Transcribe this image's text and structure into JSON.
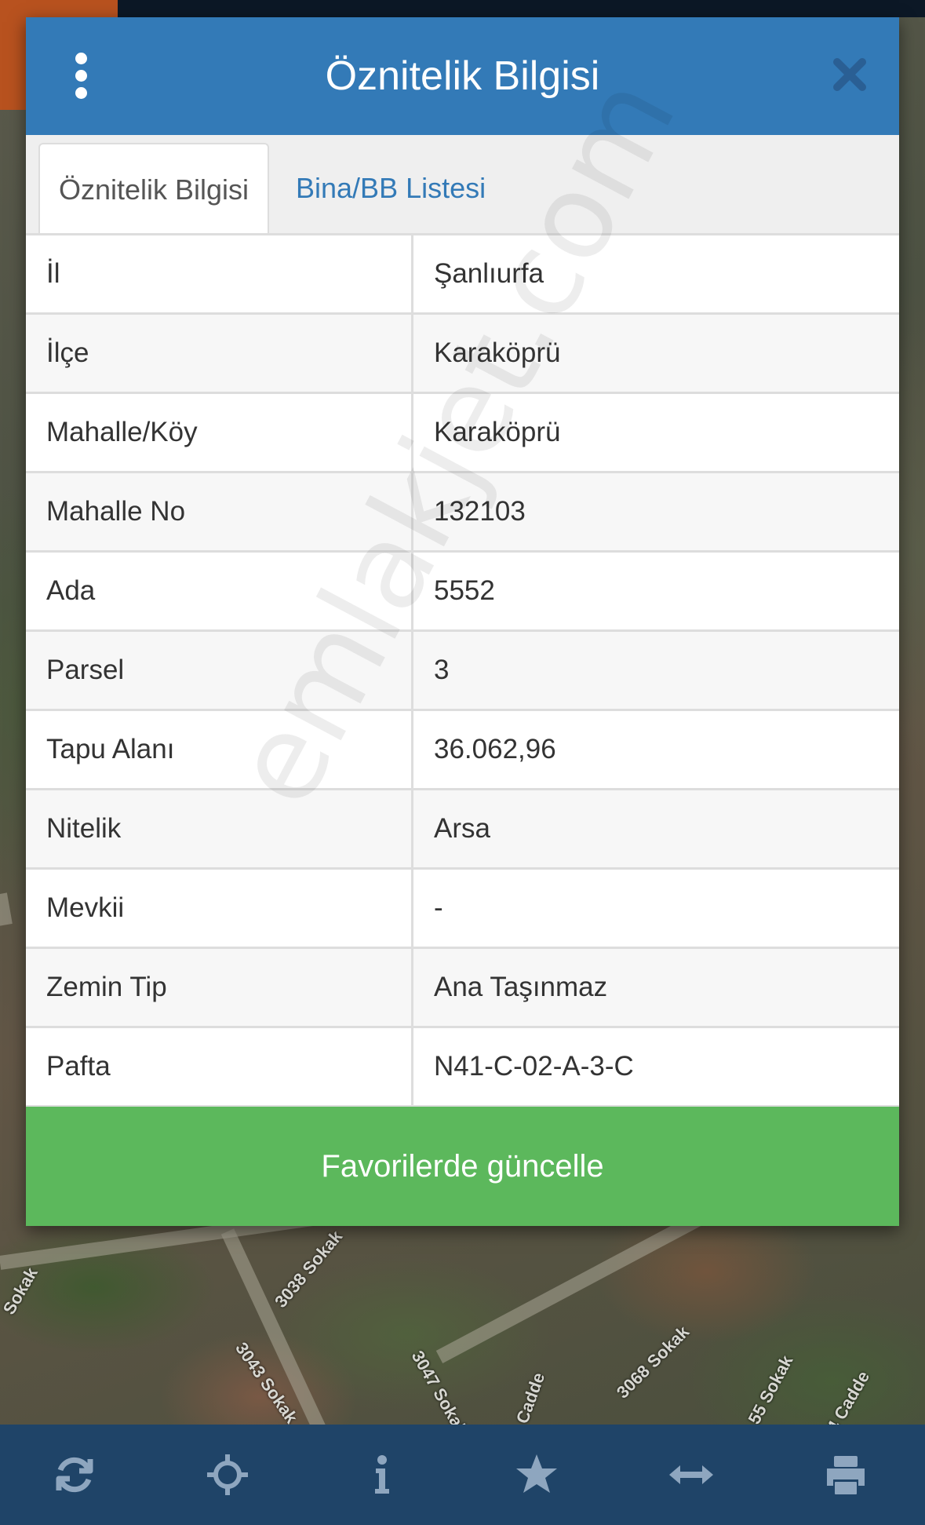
{
  "modal": {
    "title": "Öznitelik Bilgisi",
    "tabs": [
      {
        "label": "Öznitelik Bilgisi",
        "active": true
      },
      {
        "label": "Bina/BB Listesi",
        "active": false
      }
    ],
    "rows": [
      {
        "key": "İl",
        "value": "Şanlıurfa"
      },
      {
        "key": "İlçe",
        "value": "Karaköprü"
      },
      {
        "key": "Mahalle/Köy",
        "value": "Karaköprü"
      },
      {
        "key": "Mahalle No",
        "value": "132103"
      },
      {
        "key": "Ada",
        "value": "5552"
      },
      {
        "key": "Parsel",
        "value": "3"
      },
      {
        "key": "Tapu Alanı",
        "value": "36.062,96"
      },
      {
        "key": "Nitelik",
        "value": "Arsa"
      },
      {
        "key": "Mevkii",
        "value": "-"
      },
      {
        "key": "Zemin Tip",
        "value": "Ana Taşınmaz"
      },
      {
        "key": "Pafta",
        "value": "N41-C-02-A-3-C"
      }
    ],
    "favorite_button_label": "Favorilerde güncelle"
  },
  "watermark": "emlakjet.com",
  "map": {
    "street_labels": [
      "Sokak",
      "3038 Sokak",
      "3043 Sokak",
      "3047 Sokak",
      "Cadde",
      "3068 Sokak",
      "55 Sokak",
      "4 Cadde"
    ]
  },
  "toolbar": {
    "icons": [
      "refresh-icon",
      "crosshair-icon",
      "info-icon",
      "star-icon",
      "arrows-horizontal-icon",
      "print-icon"
    ]
  },
  "colors": {
    "header": "#337ab7",
    "favorite_button": "#5cb85c",
    "toolbar": "#1f4468",
    "toolbar_icon": "#8ea6bf"
  }
}
